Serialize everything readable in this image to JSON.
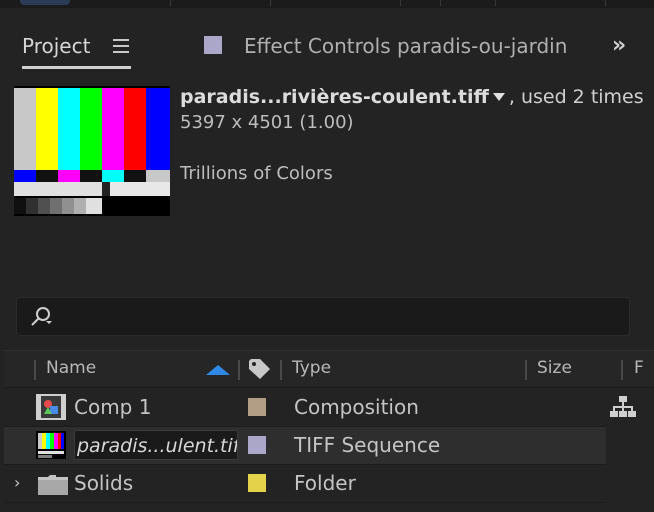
{
  "tabs": {
    "project_label": "Project",
    "effect_controls_label": "Effect Controls paradis-ou-jardins",
    "overflow_icon": "double-chevron-right-icon",
    "menu_icon": "hamburger-menu-icon"
  },
  "preview": {
    "filename": "paradis...rivières-coulent.tiff",
    "usage": ", used 2 times",
    "dimensions": "5397 x 4501 (1.00)",
    "color_depth": "Trillions of Colors"
  },
  "search": {
    "icon": "search-icon",
    "value": ""
  },
  "columns": {
    "name": "Name",
    "type": "Type",
    "size": "Size",
    "extra": "F"
  },
  "items": [
    {
      "name": "Comp 1",
      "type": "Composition",
      "label_color": "#b29e84",
      "icon": "composition-icon"
    },
    {
      "name": "paradis...ulent.tiff",
      "type": "TIFF Sequence",
      "label_color": "#aaa7c8",
      "icon": "image-sequence-icon",
      "selected": true
    },
    {
      "name": "Solids",
      "type": "Folder",
      "label_color": "#e3d24a",
      "icon": "folder-icon"
    }
  ],
  "colors": {
    "panel_bg": "#232323",
    "accent": "#2e8ae6"
  }
}
